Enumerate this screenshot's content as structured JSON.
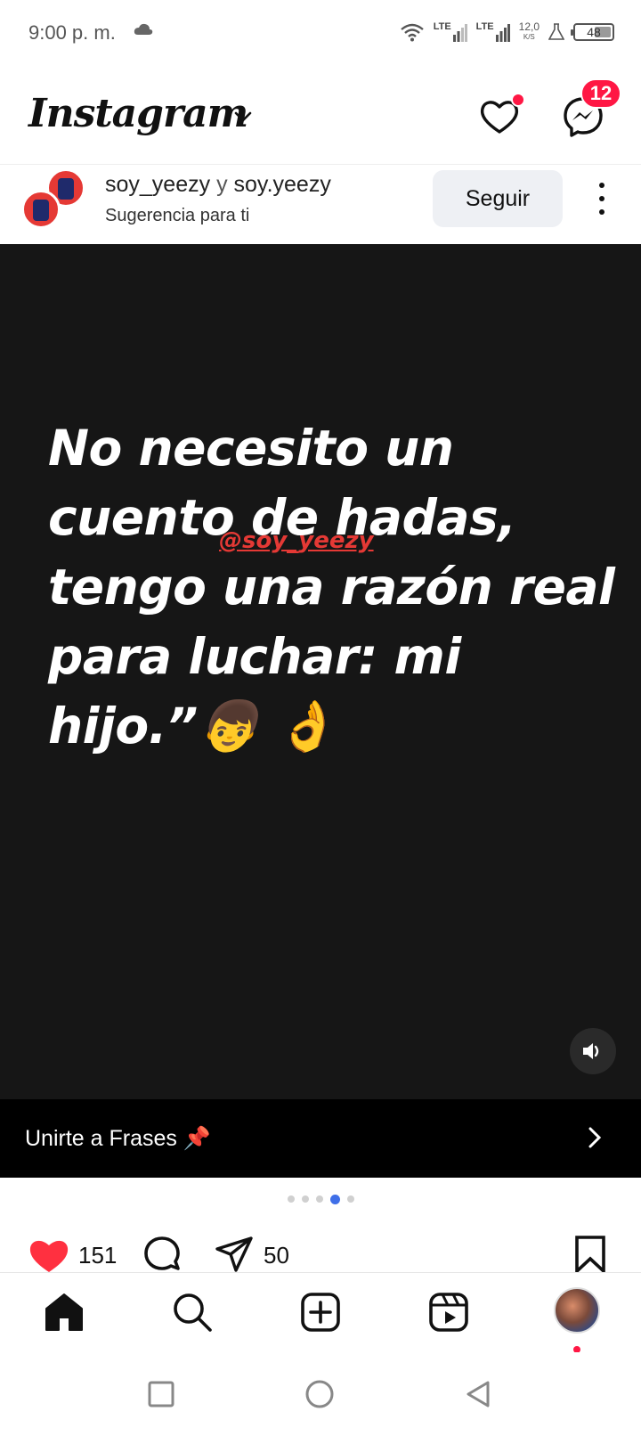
{
  "status_bar": {
    "time": "9:00 p. m.",
    "network_1": "LTE",
    "network_2": "LTE",
    "speed_value": "12,0",
    "speed_unit": "K/S",
    "battery_level": "48",
    "battery_fraction": 0.48
  },
  "header": {
    "logo": "Instagram",
    "messages_badge": "12"
  },
  "post": {
    "user_1": "soy_yeezy",
    "separator": "y",
    "user_2": "soy.yeezy",
    "subtitle": "Sugerencia para ti",
    "follow_label": "Seguir",
    "quote_text": "No necesito un cuento de hadas, tengo una razón real para luchar: mi hijo.”👦 👌",
    "watermark": "@soy_yeezy",
    "join_label": "Unirte a Frases 📌",
    "carousel": {
      "count": 5,
      "active_index": 3
    },
    "likes": "151",
    "shares": "50"
  },
  "colors": {
    "like_red": "#ff3040",
    "badge_red": "#ff1744",
    "dot_active": "#3f6fe8",
    "media_bg": "#161616"
  },
  "icons": {
    "status": [
      "cloud-icon",
      "wifi-icon",
      "signal-icon",
      "flask-icon",
      "battery-icon"
    ],
    "header": [
      "chevron-down-icon",
      "heart-icon",
      "messenger-icon"
    ],
    "actions": [
      "heart-filled-icon",
      "comment-icon",
      "send-icon",
      "bookmark-icon"
    ],
    "nav": [
      "home-icon",
      "search-icon",
      "plus-square-icon",
      "reels-icon",
      "avatar"
    ],
    "system": [
      "square-icon",
      "circle-icon",
      "triangle-back-icon"
    ]
  }
}
